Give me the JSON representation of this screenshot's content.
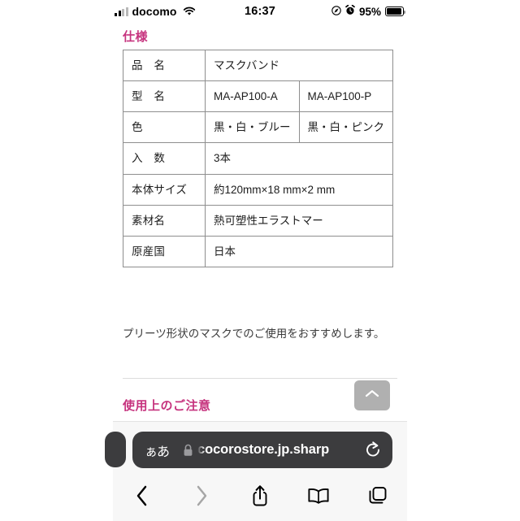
{
  "status_bar": {
    "carrier": "docomo",
    "time": "16:37",
    "battery_percent": "95%",
    "icons": [
      "signal-bars-icon",
      "wifi-icon",
      "location-arrow-icon",
      "alarm-clock-icon",
      "battery-icon"
    ]
  },
  "page": {
    "section_title": "仕様",
    "table": {
      "rows": [
        {
          "label": "品　名",
          "value1": "マスクバンド",
          "value2": null,
          "span": true
        },
        {
          "label": "型　名",
          "value1": "MA-AP100-A",
          "value2": "MA-AP100-P",
          "span": false
        },
        {
          "label": "色",
          "value1": "黒・白・ブルー",
          "value2": "黒・白・ピンク",
          "span": false
        },
        {
          "label": "入　数",
          "value1": "3本",
          "value2": null,
          "span": true
        },
        {
          "label": "本体サイズ",
          "value1": "約120mm×18 mm×2 mm",
          "value2": null,
          "span": true
        },
        {
          "label": "素材名",
          "value1": "熱可塑性エラストマー",
          "value2": null,
          "span": true
        },
        {
          "label": "原産国",
          "value1": "日本",
          "value2": null,
          "span": true
        }
      ]
    },
    "note": "プリーツ形状のマスクでのご使用をおすすめします。",
    "section_title2": "使用上のご注意",
    "scroll_top_button": "chevron-up-icon"
  },
  "browser": {
    "text_size_button": "ぁあ",
    "lock": "lock-icon",
    "url": "cocorostore.jp.sharp",
    "reload": "reload-icon",
    "toolbar": {
      "back": "chevron-left-icon",
      "forward": "chevron-right-icon",
      "share": "share-icon",
      "bookmarks": "book-icon",
      "tabs": "tabs-icon"
    }
  },
  "colors": {
    "accent_pink": "#c6337e",
    "url_bar_bg": "#3c3c3e",
    "toolbar_bg": "#f7f7f7",
    "scroll_button": "#b0b0b0"
  }
}
